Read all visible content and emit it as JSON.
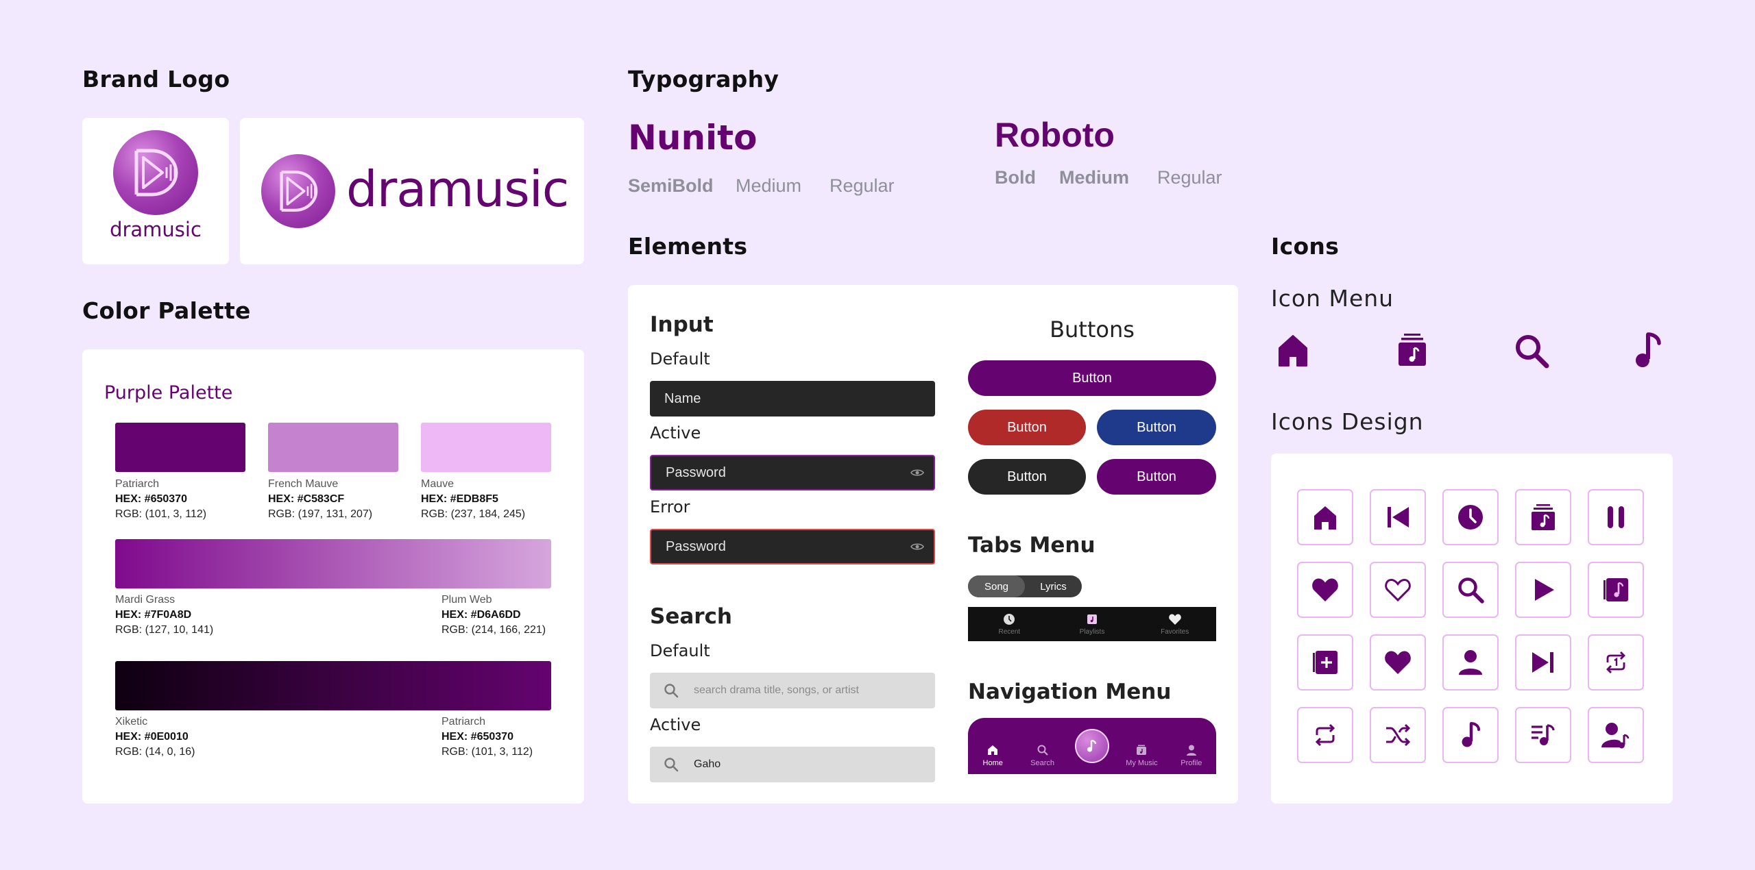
{
  "brand_logo": {
    "heading": "Brand Logo",
    "wordmark": "dramusic"
  },
  "color_palette": {
    "heading": "Color Palette",
    "card_title": "Purple Palette",
    "swatches": [
      {
        "name": "Patriarch",
        "hex": "HEX: #650370",
        "rgb": "RGB: (101, 3, 112)",
        "color": "#650370"
      },
      {
        "name": "French Mauve",
        "hex": "HEX: #C583CF",
        "rgb": "RGB: (197, 131, 207)",
        "color": "#C583CF"
      },
      {
        "name": "Mauve",
        "hex": "HEX: #EDB8F5",
        "rgb": "RGB: (237, 184, 245)",
        "color": "#EDB8F5"
      }
    ],
    "gradient1": {
      "left": {
        "name": "Mardi Grass",
        "hex": "HEX: #7F0A8D",
        "rgb": "RGB: (127, 10, 141)",
        "color": "#7F0A8D"
      },
      "right": {
        "name": "Plum Web",
        "hex": "HEX: #D6A6DD",
        "rgb": "RGB: (214, 166, 221)",
        "color": "#D6A6DD"
      }
    },
    "gradient2": {
      "left": {
        "name": "Xiketic",
        "hex": "HEX: #0E0010",
        "rgb": "RGB: (14, 0, 16)",
        "color": "#0E0010"
      },
      "right": {
        "name": "Patriarch",
        "hex": "HEX: #650370",
        "rgb": "RGB: (101, 3, 112)",
        "color": "#650370"
      }
    }
  },
  "typography": {
    "heading": "Typography",
    "fonts": [
      {
        "name": "Nunito",
        "weights": [
          "SemiBold",
          "Medium",
          "Regular"
        ]
      },
      {
        "name": "Roboto",
        "weights": [
          "Bold",
          "Medium",
          "Regular"
        ]
      }
    ]
  },
  "elements": {
    "heading": "Elements",
    "input": {
      "title": "Input",
      "default_label": "Default",
      "default_placeholder": "Name",
      "active_label": "Active",
      "active_placeholder": "Password",
      "error_label": "Error",
      "error_placeholder": "Password"
    },
    "search": {
      "title": "Search",
      "default_label": "Default",
      "default_placeholder": "search drama title, songs, or artist",
      "active_label": "Active",
      "active_value": "Gaho"
    },
    "buttons": {
      "title": "Buttons",
      "labels": [
        "Button",
        "Button",
        "Button",
        "Button",
        "Button"
      ]
    },
    "tabs_menu": {
      "title": "Tabs Menu",
      "pill": [
        "Song",
        "Lyrics"
      ],
      "bar": [
        "Recent",
        "Playlists",
        "Favorites"
      ]
    },
    "navigation_menu": {
      "title": "Navigation Menu",
      "items": [
        "Home",
        "Search",
        "My Music",
        "Profile"
      ]
    }
  },
  "icons": {
    "heading": "Icons",
    "menu_title": "Icon Menu",
    "menu_icons": [
      "home-icon",
      "music-library-icon",
      "search-icon",
      "music-note-icon"
    ],
    "design_title": "Icons Design",
    "design_icons": [
      "home-icon",
      "skip-previous-icon",
      "clock-icon",
      "music-library-icon",
      "pause-icon",
      "heart-filled-icon",
      "heart-outline-icon",
      "search-icon",
      "play-icon",
      "album-icon",
      "add-playlist-icon",
      "heart-filled-icon",
      "user-icon",
      "skip-next-icon",
      "repeat-one-icon",
      "repeat-icon",
      "shuffle-icon",
      "music-note-icon",
      "queue-music-icon",
      "artist-icon"
    ]
  },
  "colors": {
    "primary": "#650370",
    "background": "#F3E9FE",
    "button_red": "#B02A2A",
    "button_blue": "#1F3A8A",
    "button_dark": "#262626",
    "icon_border": "#E9B6F2"
  }
}
